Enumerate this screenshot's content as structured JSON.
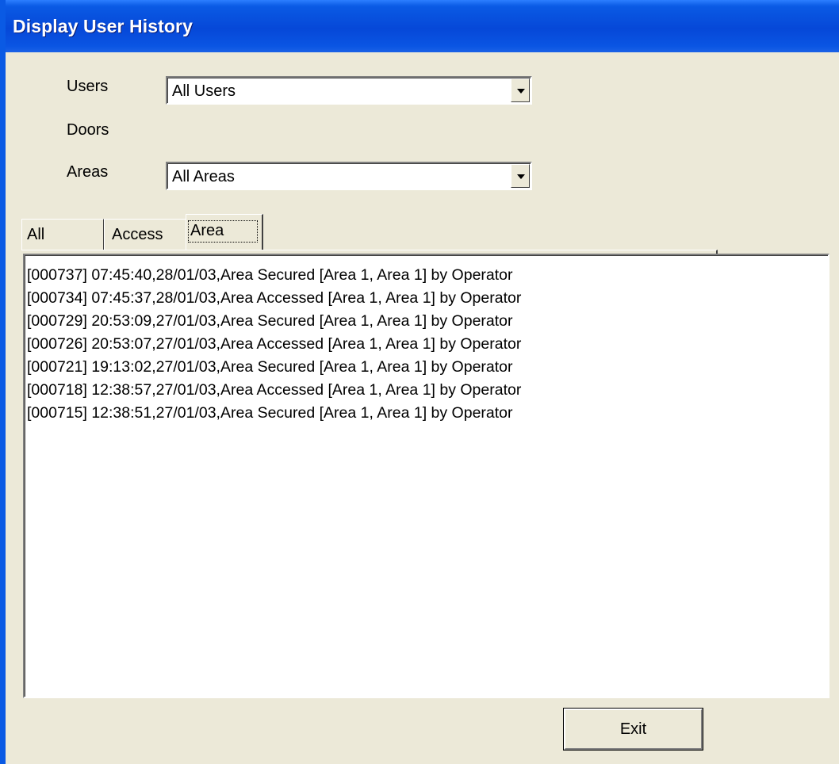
{
  "window": {
    "title": "Display User History"
  },
  "filters": {
    "users_label": "Users",
    "users_value": "All Users",
    "doors_label": "Doors",
    "areas_label": "Areas",
    "areas_value": "All Areas"
  },
  "tabs": [
    {
      "label": "All",
      "selected": false
    },
    {
      "label": "Access",
      "selected": false
    },
    {
      "label": "Area",
      "selected": true
    }
  ],
  "history": [
    "[000737] 07:45:40,28/01/03,Area Secured [Area 1, Area 1] by Operator",
    "[000734] 07:45:37,28/01/03,Area Accessed [Area 1, Area 1] by Operator",
    "[000729] 20:53:09,27/01/03,Area Secured [Area 1, Area 1] by Operator",
    "[000726] 20:53:07,27/01/03,Area Accessed [Area 1, Area 1] by Operator",
    "[000721] 19:13:02,27/01/03,Area Secured [Area 1, Area 1] by Operator",
    "[000718] 12:38:57,27/01/03,Area Accessed [Area 1, Area 1] by Operator",
    "[000715] 12:38:51,27/01/03,Area Secured [Area 1, Area 1] by Operator"
  ],
  "buttons": {
    "exit_label": "Exit"
  },
  "icons": {
    "dropdown": "chevron-down-icon"
  }
}
